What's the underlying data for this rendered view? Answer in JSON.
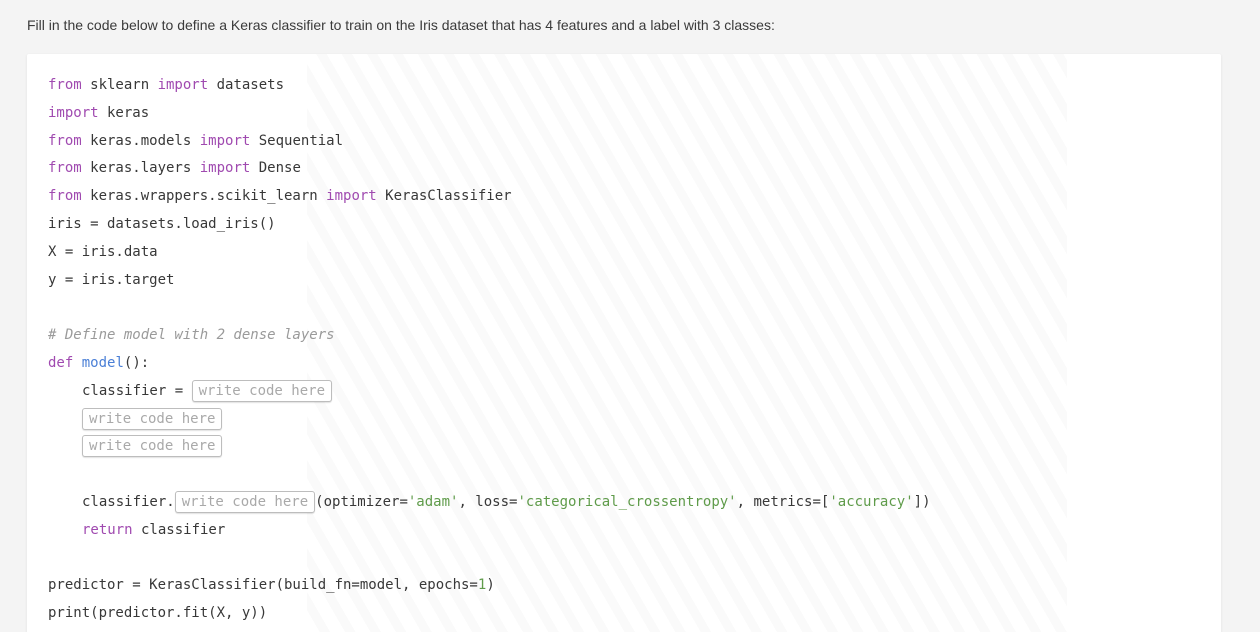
{
  "instructions": "Fill in the code below to define a Keras classifier to train on the Iris dataset that has 4 features and a label with 3 classes:",
  "code": {
    "l1": [
      "from",
      " sklearn ",
      "import",
      " datasets"
    ],
    "l2": [
      "import",
      " keras"
    ],
    "l3": [
      "from",
      " keras.models ",
      "import",
      " Sequential"
    ],
    "l4": [
      "from",
      " keras.layers ",
      "import",
      " Dense"
    ],
    "l5": [
      "from",
      " keras.wrappers.scikit_learn ",
      "import",
      " KerasClassifier"
    ],
    "l6": "iris = datasets.load_iris()",
    "l7": "X = iris.data",
    "l8": "y = iris.target",
    "comment": "# Define model with 2 dense layers",
    "def_kw": "def",
    "def_fn": "model",
    "def_rest": "():",
    "classifier_assign": "classifier = ",
    "classifier_dot": "classifier.",
    "compile_open": "(optimizer=",
    "compile_opt": "'adam'",
    "compile_loss_label": ", loss=",
    "compile_loss": "'categorical_crossentropy'",
    "compile_metrics_label": ", metrics=[",
    "compile_metrics": "'accuracy'",
    "compile_close": "])",
    "return_kw": "return",
    "return_rest": " classifier",
    "predictor_pre": "predictor = KerasClassifier(build_fn=model, epochs=",
    "predictor_num": "1",
    "predictor_post": ")",
    "print_line": "print(predictor.fit(X, y))"
  },
  "blanks": {
    "placeholder": "write code here"
  },
  "colors": {
    "keyword": "#a04ab0",
    "function": "#4a7fd6",
    "string": "#5f9b4a",
    "comment": "#9a9a9a"
  }
}
